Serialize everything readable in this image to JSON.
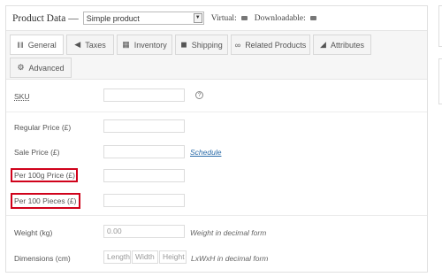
{
  "header": {
    "title": "Product Data —",
    "product_type": "Simple product",
    "virtual_label": "Virtual:",
    "downloadable_label": "Downloadable:"
  },
  "tabs": [
    {
      "label": "General",
      "icon": "sliders-icon",
      "active": true
    },
    {
      "label": "Taxes",
      "icon": "tag-icon"
    },
    {
      "label": "Inventory",
      "icon": "boxes-icon"
    },
    {
      "label": "Shipping",
      "icon": "truck-icon"
    },
    {
      "label": "Related Products",
      "icon": "link-icon"
    },
    {
      "label": "Attributes",
      "icon": "ruler-icon"
    },
    {
      "label": "Advanced",
      "icon": "gear-icon"
    }
  ],
  "fields": {
    "sku": {
      "label": "SKU",
      "value": ""
    },
    "regular_price": {
      "label": "Regular Price (£)",
      "value": ""
    },
    "sale_price": {
      "label": "Sale Price (£)",
      "value": "",
      "link": "Schedule"
    },
    "per_100g": {
      "label": "Per 100g Price (£)",
      "value": ""
    },
    "per_100_pieces": {
      "label": "Per 100 Pieces (£)",
      "value": ""
    },
    "weight": {
      "label": "Weight (kg)",
      "placeholder": "0.00",
      "hint": "Weight in decimal form"
    },
    "dimensions": {
      "label": "Dimensions (cm)",
      "length_placeholder": "Length",
      "width_placeholder": "Width",
      "height_placeholder": "Height",
      "hint": "LxWxH in decimal form"
    }
  },
  "help_icon": "?",
  "highlight_color": "#d0021b"
}
